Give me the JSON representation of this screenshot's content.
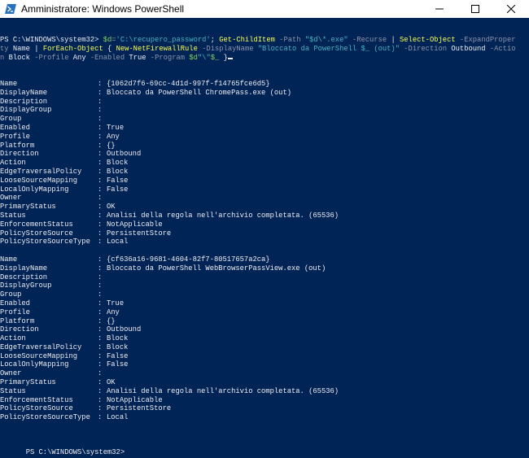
{
  "window": {
    "title": "Amministratore: Windows PowerShell"
  },
  "console": {
    "command_line1": [
      {
        "t": "PS C:\\WINDOWS\\system32> ",
        "c": "w"
      },
      {
        "t": "$d",
        "c": "v"
      },
      {
        "t": "=",
        "c": "g"
      },
      {
        "t": "'C:\\recupero_password'",
        "c": "s"
      },
      {
        "t": "; ",
        "c": "w"
      },
      {
        "t": "Get-ChildItem",
        "c": "y"
      },
      {
        "t": " -Path ",
        "c": "g"
      },
      {
        "t": "\"$d\\*.exe\"",
        "c": "s"
      },
      {
        "t": " -Recurse ",
        "c": "g"
      },
      {
        "t": "| ",
        "c": "w"
      },
      {
        "t": "Select-Object",
        "c": "y"
      },
      {
        "t": " -ExpandProper",
        "c": "g"
      }
    ],
    "command_line2": [
      {
        "t": "ty ",
        "c": "g"
      },
      {
        "t": "Name ",
        "c": "w"
      },
      {
        "t": "| ",
        "c": "w"
      },
      {
        "t": "ForEach-Object",
        "c": "y"
      },
      {
        "t": " { ",
        "c": "w"
      },
      {
        "t": "New-NetFirewallRule",
        "c": "y"
      },
      {
        "t": " -DisplayName ",
        "c": "g"
      },
      {
        "t": "\"Bloccato da PowerShell $_ (out)\"",
        "c": "s"
      },
      {
        "t": " -Direction ",
        "c": "g"
      },
      {
        "t": "Outbound",
        "c": "w"
      },
      {
        "t": " -Actio",
        "c": "g"
      }
    ],
    "command_line3": [
      {
        "t": "n ",
        "c": "g"
      },
      {
        "t": "Block",
        "c": "w"
      },
      {
        "t": " -Profile ",
        "c": "g"
      },
      {
        "t": "Any",
        "c": "w"
      },
      {
        "t": " -Enabled ",
        "c": "g"
      },
      {
        "t": "True",
        "c": "w"
      },
      {
        "t": " -Program ",
        "c": "g"
      },
      {
        "t": "$d",
        "c": "v"
      },
      {
        "t": "\"\\\"",
        "c": "s"
      },
      {
        "t": "$_",
        "c": "v"
      },
      {
        "t": " }",
        "c": "w"
      }
    ],
    "rules": [
      {
        "props": [
          {
            "k": "Name",
            "v": "{1062d7f6-69cc-4d1d-997f-f14765fce6d5}"
          },
          {
            "k": "DisplayName",
            "v": "Bloccato da PowerShell ChromePass.exe (out)"
          },
          {
            "k": "Description",
            "v": ""
          },
          {
            "k": "DisplayGroup",
            "v": ""
          },
          {
            "k": "Group",
            "v": ""
          },
          {
            "k": "Enabled",
            "v": "True"
          },
          {
            "k": "Profile",
            "v": "Any"
          },
          {
            "k": "Platform",
            "v": "{}"
          },
          {
            "k": "Direction",
            "v": "Outbound"
          },
          {
            "k": "Action",
            "v": "Block"
          },
          {
            "k": "EdgeTraversalPolicy",
            "v": "Block"
          },
          {
            "k": "LooseSourceMapping",
            "v": "False"
          },
          {
            "k": "LocalOnlyMapping",
            "v": "False"
          },
          {
            "k": "Owner",
            "v": ""
          },
          {
            "k": "PrimaryStatus",
            "v": "OK"
          },
          {
            "k": "Status",
            "v": "Analisi della regola nell'archivio completata. (65536)"
          },
          {
            "k": "EnforcementStatus",
            "v": "NotApplicable"
          },
          {
            "k": "PolicyStoreSource",
            "v": "PersistentStore"
          },
          {
            "k": "PolicyStoreSourceType",
            "v": "Local"
          }
        ]
      },
      {
        "props": [
          {
            "k": "Name",
            "v": "{cf636a16-9681-4604-82f7-80517657a2ca}"
          },
          {
            "k": "DisplayName",
            "v": "Bloccato da PowerShell WebBrowserPassView.exe (out)"
          },
          {
            "k": "Description",
            "v": ""
          },
          {
            "k": "DisplayGroup",
            "v": ""
          },
          {
            "k": "Group",
            "v": ""
          },
          {
            "k": "Enabled",
            "v": "True"
          },
          {
            "k": "Profile",
            "v": "Any"
          },
          {
            "k": "Platform",
            "v": "{}"
          },
          {
            "k": "Direction",
            "v": "Outbound"
          },
          {
            "k": "Action",
            "v": "Block"
          },
          {
            "k": "EdgeTraversalPolicy",
            "v": "Block"
          },
          {
            "k": "LooseSourceMapping",
            "v": "False"
          },
          {
            "k": "LocalOnlyMapping",
            "v": "False"
          },
          {
            "k": "Owner",
            "v": ""
          },
          {
            "k": "PrimaryStatus",
            "v": "OK"
          },
          {
            "k": "Status",
            "v": "Analisi della regola nell'archivio completata. (65536)"
          },
          {
            "k": "EnforcementStatus",
            "v": "NotApplicable"
          },
          {
            "k": "PolicyStoreSource",
            "v": "PersistentStore"
          },
          {
            "k": "PolicyStoreSourceType",
            "v": "Local"
          }
        ]
      }
    ],
    "final_prompt": "PS C:\\WINDOWS\\system32>"
  },
  "colors": {
    "console_background": "#012456",
    "cmdlet": "#fffe54",
    "parameter": "#8e95a8",
    "string": "#4ab3c0",
    "variable": "#87cf5b",
    "text": "#eeedf0"
  },
  "icons": {
    "app": "powershell-icon",
    "minimize": "minimize-icon",
    "maximize": "maximize-icon",
    "close": "close-icon"
  }
}
